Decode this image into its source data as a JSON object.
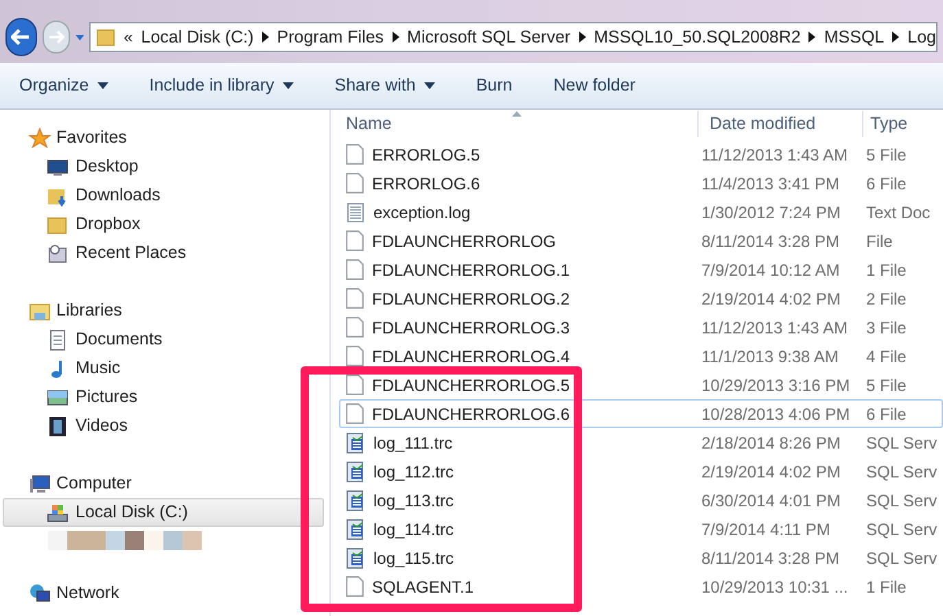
{
  "address_bar": {
    "overflow": "«",
    "crumbs": [
      "Local Disk (C:)",
      "Program Files",
      "Microsoft SQL Server",
      "MSSQL10_50.SQL2008R2",
      "MSSQL",
      "Log"
    ]
  },
  "toolbar": [
    {
      "label": "Organize",
      "dropdown": true
    },
    {
      "label": "Include in library",
      "dropdown": true
    },
    {
      "label": "Share with",
      "dropdown": true
    },
    {
      "label": "Burn",
      "dropdown": false
    },
    {
      "label": "New folder",
      "dropdown": false
    }
  ],
  "sidebar": {
    "groups": [
      {
        "label": "Favorites",
        "kind": "favorites",
        "children": [
          {
            "label": "Desktop",
            "kind": "desktop",
            "selected": false
          },
          {
            "label": "Downloads",
            "kind": "downloads",
            "selected": false
          },
          {
            "label": "Dropbox",
            "kind": "folder",
            "selected": false
          },
          {
            "label": "Recent Places",
            "kind": "recent",
            "selected": false
          }
        ]
      },
      {
        "label": "Libraries",
        "kind": "libraries",
        "children": [
          {
            "label": "Documents",
            "kind": "documents",
            "selected": false
          },
          {
            "label": "Music",
            "kind": "music",
            "selected": false
          },
          {
            "label": "Pictures",
            "kind": "pictures",
            "selected": false
          },
          {
            "label": "Videos",
            "kind": "videos",
            "selected": false
          }
        ]
      },
      {
        "label": "Computer",
        "kind": "computer",
        "blurred_entry": true,
        "children": [
          {
            "label": "Local Disk (C:)",
            "kind": "disk",
            "selected": true
          }
        ]
      },
      {
        "label": "Network",
        "kind": "network"
      }
    ]
  },
  "file_list": {
    "columns": [
      "Name",
      "Date modified",
      "Type"
    ],
    "rows": [
      {
        "name": "ERRORLOG.5",
        "date": "11/12/2013 1:43 AM",
        "type": "5 File",
        "kind": "file",
        "selected": false
      },
      {
        "name": "ERRORLOG.6",
        "date": "11/4/2013 3:41 PM",
        "type": "6 File",
        "kind": "file",
        "selected": false
      },
      {
        "name": "exception.log",
        "date": "1/30/2012 7:24 PM",
        "type": "Text Doc",
        "kind": "text",
        "selected": false
      },
      {
        "name": "FDLAUNCHERRORLOG",
        "date": "8/11/2014 3:28 PM",
        "type": "File",
        "kind": "file",
        "selected": false
      },
      {
        "name": "FDLAUNCHERRORLOG.1",
        "date": "7/9/2014 10:12 AM",
        "type": "1 File",
        "kind": "file",
        "selected": false
      },
      {
        "name": "FDLAUNCHERRORLOG.2",
        "date": "2/19/2014 4:02 PM",
        "type": "2 File",
        "kind": "file",
        "selected": false
      },
      {
        "name": "FDLAUNCHERRORLOG.3",
        "date": "11/12/2013 1:43 AM",
        "type": "3 File",
        "kind": "file",
        "selected": false
      },
      {
        "name": "FDLAUNCHERRORLOG.4",
        "date": "11/1/2013 9:38 AM",
        "type": "4 File",
        "kind": "file",
        "selected": false
      },
      {
        "name": "FDLAUNCHERRORLOG.5",
        "date": "10/29/2013 3:16 PM",
        "type": "5 File",
        "kind": "file",
        "selected": false
      },
      {
        "name": "FDLAUNCHERRORLOG.6",
        "date": "10/28/2013 4:06 PM",
        "type": "6 File",
        "kind": "file",
        "selected": true
      },
      {
        "name": "log_111.trc",
        "date": "2/18/2014 8:26 PM",
        "type": "SQL Serv",
        "kind": "trace",
        "selected": false
      },
      {
        "name": "log_112.trc",
        "date": "2/19/2014 4:02 PM",
        "type": "SQL Serv",
        "kind": "trace",
        "selected": false
      },
      {
        "name": "log_113.trc",
        "date": "6/30/2014 4:01 PM",
        "type": "SQL Serv",
        "kind": "trace",
        "selected": false
      },
      {
        "name": "log_114.trc",
        "date": "7/9/2014 4:11 PM",
        "type": "SQL Serv",
        "kind": "trace",
        "selected": false
      },
      {
        "name": "log_115.trc",
        "date": "8/11/2014 3:28 PM",
        "type": "SQL Serv",
        "kind": "trace",
        "selected": false
      },
      {
        "name": "SQLAGENT.1",
        "date": "10/29/2013 10:31 ...",
        "type": "1 File",
        "kind": "file",
        "selected": false
      }
    ]
  },
  "annotation": {
    "highlight": true
  }
}
